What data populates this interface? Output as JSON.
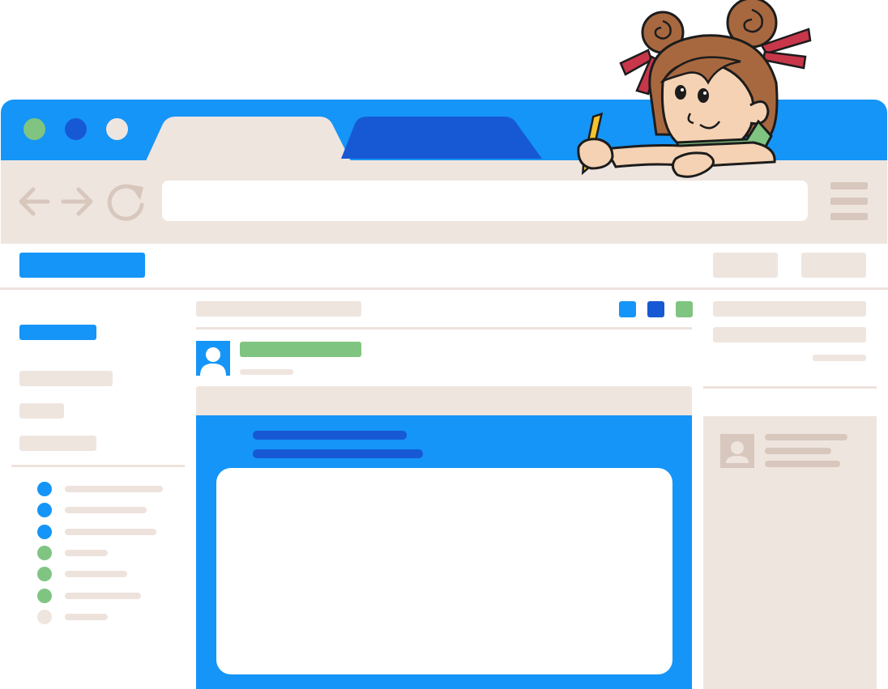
{
  "colors": {
    "primary_blue": "#1595f7",
    "navy": "#1759d4",
    "green": "#7fc581",
    "beige": "#efe5df",
    "beige_dark": "#d8c7bd"
  },
  "window": {
    "controls": [
      {
        "name": "green-dot",
        "color": "#7fc581"
      },
      {
        "name": "navy-dot",
        "color": "#1759d4"
      },
      {
        "name": "beige-dot",
        "color": "#efe5df"
      }
    ],
    "tabs": [
      {
        "state": "active"
      },
      {
        "state": "inactive"
      }
    ]
  },
  "nav": {
    "icons": [
      "back-arrow-icon",
      "forward-arrow-icon",
      "reload-icon"
    ],
    "menu_icon": "hamburger-menu-icon"
  },
  "sidebar": {
    "list_items": [
      {
        "color": "#1595f7"
      },
      {
        "color": "#1595f7"
      },
      {
        "color": "#1595f7"
      },
      {
        "color": "#7fc581"
      },
      {
        "color": "#7fc581"
      },
      {
        "color": "#7fc581"
      },
      {
        "color": "#efe5df"
      }
    ]
  },
  "toolbar_squares": [
    "#1595f7",
    "#1759d4",
    "#7fc581"
  ],
  "illustration": "girl-drawing-with-pencil"
}
